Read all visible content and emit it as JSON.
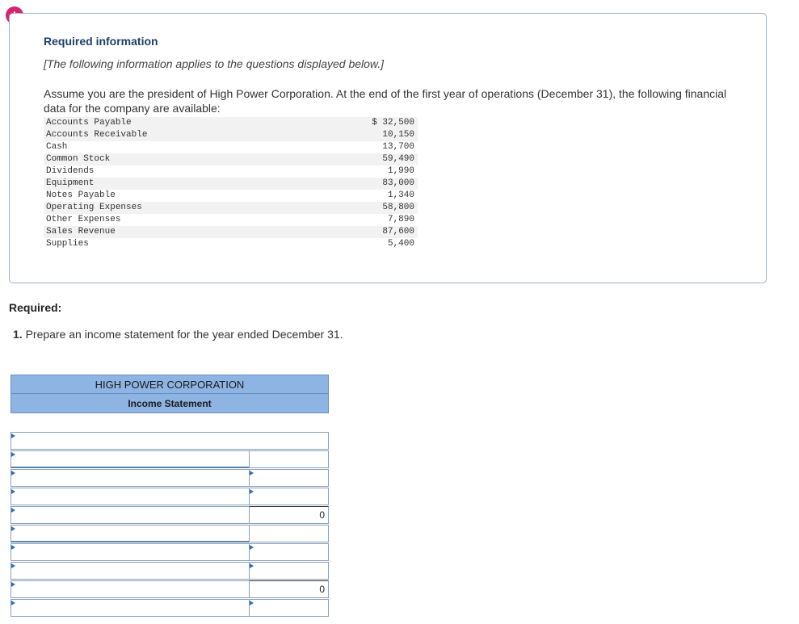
{
  "alert_icon": "exclamation-icon",
  "info": {
    "title": "Required information",
    "subtitle": "[The following information applies to the questions displayed below.]",
    "paragraph": "Assume you are the president of High Power Corporation. At the end of the first year of operations (December 31), the following financial data for the company are available:"
  },
  "accounts": [
    {
      "label": "Accounts Payable",
      "value": "$ 32,500"
    },
    {
      "label": "Accounts Receivable",
      "value": "10,150"
    },
    {
      "label": "Cash",
      "value": "13,700"
    },
    {
      "label": "Common Stock",
      "value": "59,490"
    },
    {
      "label": "Dividends",
      "value": "1,990"
    },
    {
      "label": "Equipment",
      "value": "83,000"
    },
    {
      "label": "Notes Payable",
      "value": "1,340"
    },
    {
      "label": "Operating Expenses",
      "value": "58,800"
    },
    {
      "label": "Other Expenses",
      "value": "7,890"
    },
    {
      "label": "Sales Revenue",
      "value": "87,600"
    },
    {
      "label": "Supplies",
      "value": "5,400"
    }
  ],
  "required": {
    "label": "Required:",
    "number": "1.",
    "text": " Prepare an income statement for the year ended December 31."
  },
  "statement": {
    "company": "HIGH POWER CORPORATION",
    "title": "Income Statement",
    "totals": [
      "0",
      "0"
    ]
  }
}
